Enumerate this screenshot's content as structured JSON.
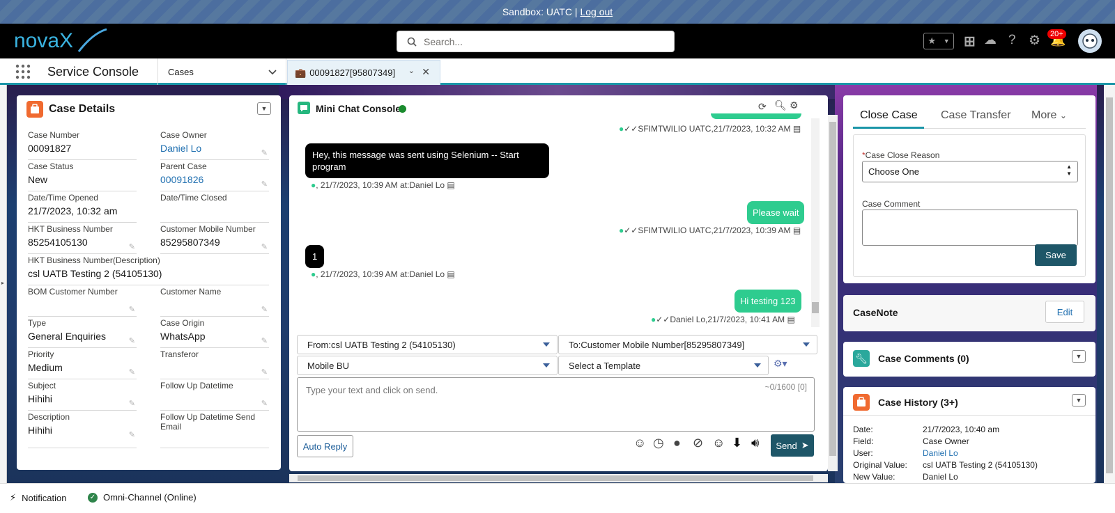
{
  "sandbox": {
    "text": "Sandbox: UATC |",
    "logout": "Log out"
  },
  "header": {
    "logo_text": "novaX",
    "search_placeholder": "Search...",
    "notification_count": "20+"
  },
  "nav": {
    "app_name": "Service Console",
    "cases_label": "Cases",
    "tab_label": "00091827[95807349]"
  },
  "case_details": {
    "title": "Case Details",
    "fields": [
      {
        "label": "Case Number",
        "value": "00091827"
      },
      {
        "label": "Case Owner",
        "value": "Daniel Lo"
      },
      {
        "label": "Case Status",
        "value": "New"
      },
      {
        "label": "Parent Case",
        "value": "00091826"
      },
      {
        "label": "Date/Time Opened",
        "value": "21/7/2023, 10:32 am"
      },
      {
        "label": "Date/Time Closed",
        "value": ""
      },
      {
        "label": "HKT Business Number",
        "value": "85254105130"
      },
      {
        "label": "Customer Mobile Number",
        "value": "85295807349"
      },
      {
        "label": "HKT Business Number(Description)",
        "value": "csl UATB Testing 2 (54105130)"
      },
      {
        "label": "BOM Customer Number",
        "value": ""
      },
      {
        "label": "Customer Name",
        "value": ""
      },
      {
        "label": "Type",
        "value": "General Enquiries"
      },
      {
        "label": "Case Origin",
        "value": "WhatsApp"
      },
      {
        "label": "Priority",
        "value": "Medium"
      },
      {
        "label": "Transferor",
        "value": ""
      },
      {
        "label": "Subject",
        "value": "Hihihi"
      },
      {
        "label": "Follow Up Datetime",
        "value": ""
      },
      {
        "label": "Description",
        "value": "Hihihi"
      },
      {
        "label": "Follow Up Datetime Send Email",
        "value": ""
      }
    ]
  },
  "chat": {
    "title": "Mini Chat Console",
    "messages": [
      {
        "meta": "✓✓SFIMTWILIO UATC,21/7/2023, 10:32 AM"
      },
      {
        "text": "Hey, this message was sent using Selenium -- Start program",
        "meta": ", 21/7/2023, 10:39 AM at:Daniel Lo"
      },
      {
        "text": "Please wait",
        "meta": "✓✓SFIMTWILIO UATC,21/7/2023, 10:39 AM"
      },
      {
        "text": "1",
        "meta": ", 21/7/2023, 10:39 AM at:Daniel Lo"
      },
      {
        "text": "Hi testing 123",
        "meta": "✓✓Daniel Lo,21/7/2023, 10:41 AM"
      }
    ],
    "from": "From:csl UATB Testing 2 (54105130)",
    "to": "To:Customer Mobile Number[85295807349]",
    "bu": "Mobile BU",
    "template": "Select a Template",
    "input_placeholder": "Type your text and click on send.",
    "counter": "~0/1600 [0]",
    "auto_reply": "Auto Reply",
    "send": "Send"
  },
  "close_case": {
    "tabs": [
      "Close Case",
      "Case Transfer",
      "More"
    ],
    "reason_label": "Case Close Reason",
    "reason_value": "Choose One",
    "comment_label": "Case Comment",
    "save": "Save"
  },
  "casenote": {
    "title": "CaseNote",
    "edit": "Edit"
  },
  "case_comments": {
    "title": "Case Comments (0)"
  },
  "case_history": {
    "title": "Case History (3+)",
    "rows": [
      {
        "k": "Date:",
        "v": "21/7/2023, 10:40 am"
      },
      {
        "k": "Field:",
        "v": "Case Owner"
      },
      {
        "k": "User:",
        "v": "Daniel Lo"
      },
      {
        "k": "Original Value:",
        "v": "csl UATB Testing 2 (54105130)"
      },
      {
        "k": "New Value:",
        "v": "Daniel Lo"
      }
    ]
  },
  "footer": {
    "notification": "Notification",
    "omni": "Omni-Channel (Online)"
  },
  "colors": {
    "accent": "#1b96a8",
    "brand_button": "#1e5668",
    "chat_out": "#2ecc8f",
    "case_icon": "#f06a30"
  }
}
